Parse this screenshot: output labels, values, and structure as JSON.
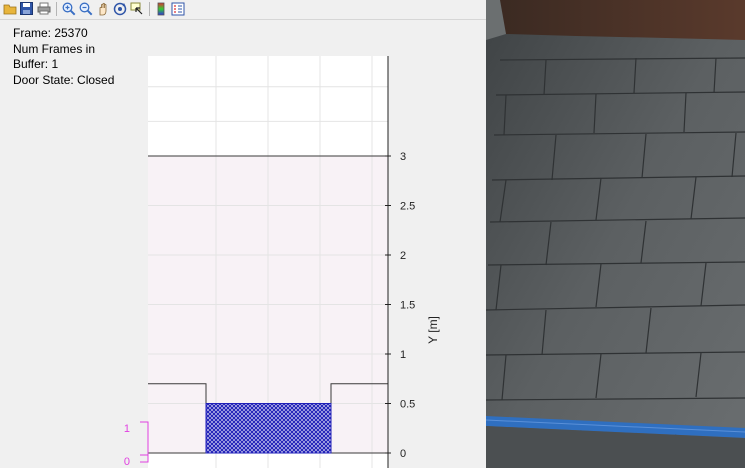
{
  "toolbar": {
    "icons": [
      "open-file-icon",
      "save-icon",
      "print-icon",
      "zoom-in-icon",
      "zoom-out-icon",
      "pan-icon",
      "rotate-icon",
      "data-cursor-icon",
      "colorbar-icon",
      "legend-icon"
    ]
  },
  "info": {
    "frame": "Frame: 25370",
    "num_frames_line1": "Num Frames in",
    "num_frames_line2": "Buffer: 1",
    "door_state": "Door State: Closed"
  },
  "chart_data": {
    "type": "area",
    "ylabel": "Y [m]",
    "y_ticks": [
      "0",
      "0.5",
      "1",
      "1.5",
      "2",
      "2.5",
      "3"
    ],
    "y_tick_values": [
      0,
      0.5,
      1,
      1.5,
      2,
      2.5,
      3
    ],
    "ylim": [
      -0.15,
      4.05
    ],
    "door_region": {
      "y_bottom": 0,
      "y_top": 3
    },
    "door_shape_y": 0.7,
    "occupancy_box": {
      "y_bottom": 0,
      "y_top": 0.5
    },
    "left_axis_ticks": [
      "1",
      "0"
    ],
    "colors": {
      "region_fill": "#f8f2f6",
      "occupancy": "#1f1fb8",
      "left_axis": "#e040e0",
      "outline": "#3a3a3a"
    }
  },
  "camera": {
    "description_colors": {
      "floor": "#55595b",
      "wall": "#4a3228",
      "tape": "#2f6fc0"
    }
  }
}
